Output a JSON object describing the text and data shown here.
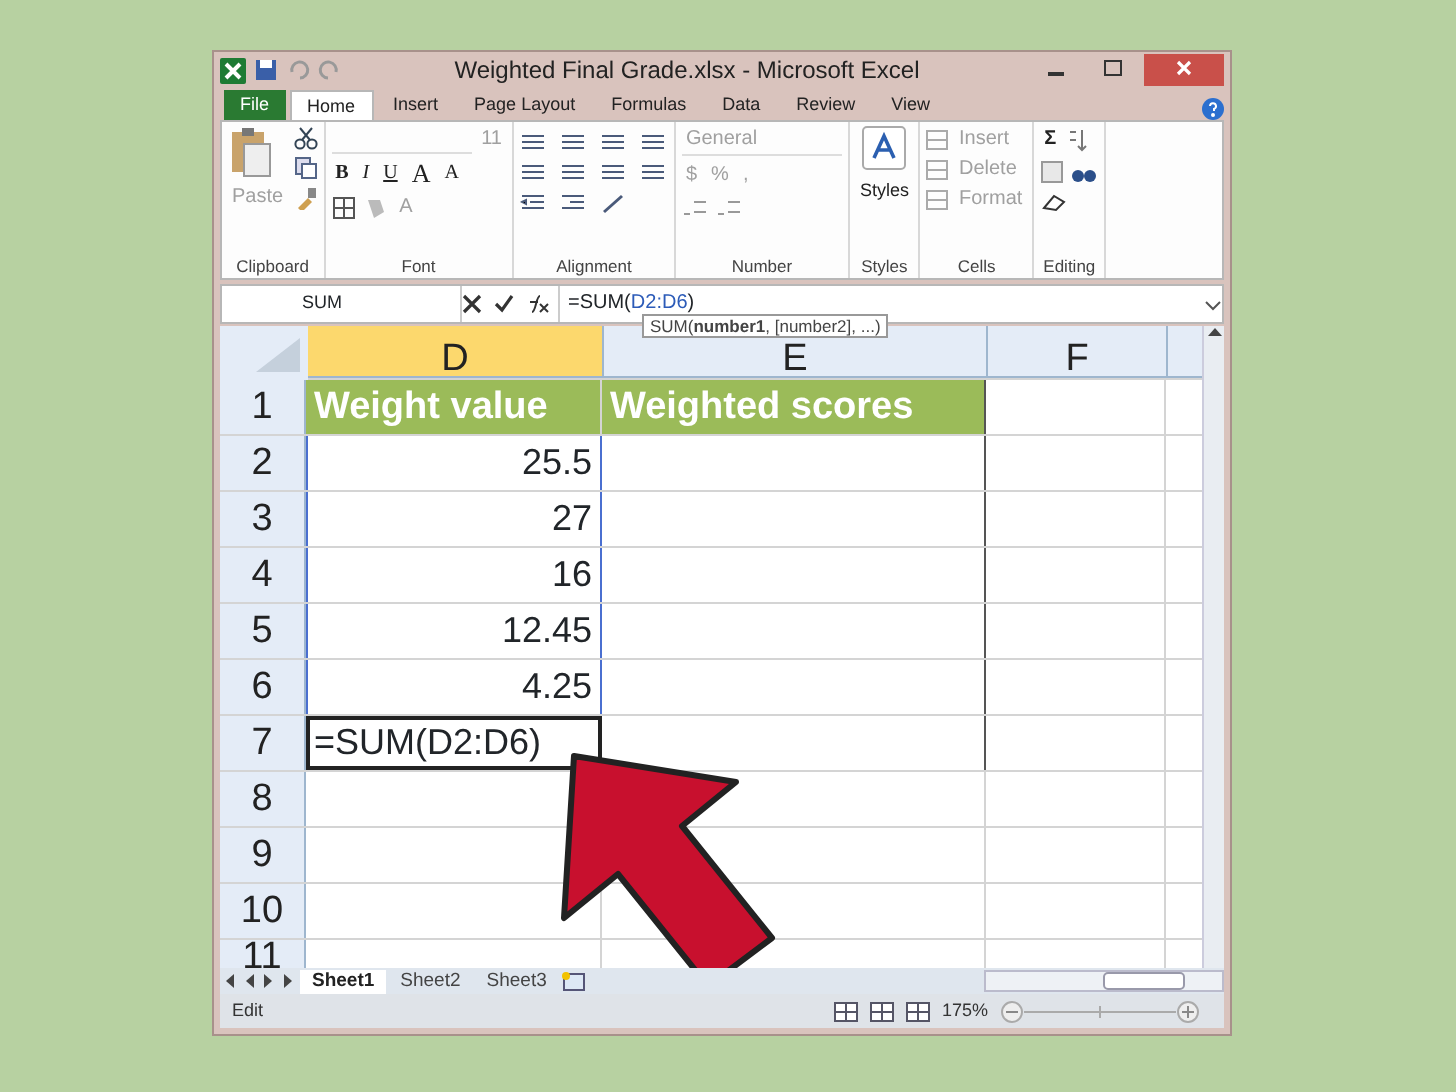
{
  "window": {
    "title": "Weighted Final Grade.xlsx - Microsoft Excel"
  },
  "ribbon_tabs": [
    {
      "label": "File",
      "kind": "file",
      "selected": false
    },
    {
      "label": "Home",
      "kind": "tab",
      "selected": true
    },
    {
      "label": "Insert",
      "kind": "tab",
      "selected": false
    },
    {
      "label": "Page Layout",
      "kind": "tab",
      "selected": false
    },
    {
      "label": "Formulas",
      "kind": "tab",
      "selected": false
    },
    {
      "label": "Data",
      "kind": "tab",
      "selected": false
    },
    {
      "label": "Review",
      "kind": "tab",
      "selected": false
    },
    {
      "label": "View",
      "kind": "tab",
      "selected": false
    }
  ],
  "ribbon_groups": [
    {
      "kind": "clipboard",
      "label": "Clipboard",
      "items": [
        {
          "label": "Paste",
          "disabled": true
        }
      ]
    },
    {
      "kind": "font",
      "label": "Font",
      "items": [
        {
          "label": "11",
          "disabled": true
        },
        {
          "label": "B",
          "disabled": false
        },
        {
          "label": "I",
          "disabled": false
        },
        {
          "label": "U",
          "disabled": false
        },
        {
          "label": "A",
          "disabled": false
        },
        {
          "label": "A",
          "disabled": false
        },
        {
          "label": "A",
          "disabled": true
        }
      ]
    },
    {
      "kind": "alignment",
      "label": "Alignment"
    },
    {
      "kind": "number",
      "label": "Number",
      "items": [
        {
          "label": "General",
          "disabled": true
        },
        {
          "label": "$",
          "disabled": true
        },
        {
          "label": "%",
          "disabled": true
        },
        {
          "label": ",",
          "disabled": true
        }
      ]
    },
    {
      "kind": "styles",
      "label": "Styles",
      "items": [
        {
          "label": "Styles",
          "disabled": false
        }
      ]
    },
    {
      "kind": "cells",
      "label": "Cells",
      "items": [
        {
          "label": "Insert",
          "disabled": true
        },
        {
          "label": "Delete",
          "disabled": true
        },
        {
          "label": "Format",
          "disabled": true
        }
      ]
    },
    {
      "kind": "editing",
      "label": "Editing",
      "items": [
        {
          "label": "Σ",
          "disabled": false
        }
      ]
    }
  ],
  "formula_bar": {
    "name_box": "SUM",
    "formula": [
      {
        "text": "=SUM(",
        "kind": "plain"
      },
      {
        "text": "D2:D6",
        "kind": "reference"
      },
      {
        "text": ")",
        "kind": "plain"
      }
    ],
    "tooltip": "SUM(**number1**, [number2], ...)"
  },
  "columns": [
    {
      "label": "D",
      "selected": true
    },
    {
      "label": "E",
      "selected": false
    },
    {
      "label": "F",
      "selected": false
    }
  ],
  "rows": [
    {
      "row": "1",
      "kind": "header",
      "d": "Weight value",
      "e": "Weighted scores"
    },
    {
      "row": "2",
      "kind": "value",
      "d": "25.5",
      "referenced": true
    },
    {
      "row": "3",
      "kind": "value",
      "d": "27",
      "referenced": true
    },
    {
      "row": "4",
      "kind": "value",
      "d": "16",
      "referenced": true
    },
    {
      "row": "5",
      "kind": "value",
      "d": "12.45",
      "referenced": true
    },
    {
      "row": "6",
      "kind": "value",
      "d": "4.25",
      "referenced": true
    },
    {
      "row": "7",
      "kind": "formula",
      "d": "=SUM(D2:D6)",
      "active": true
    },
    {
      "row": "8",
      "kind": "empty"
    },
    {
      "row": "9",
      "kind": "empty"
    },
    {
      "row": "10",
      "kind": "empty"
    },
    {
      "row": "11",
      "kind": "empty"
    }
  ],
  "sheet_tabs": [
    {
      "label": "Sheet1",
      "selected": true
    },
    {
      "label": "Sheet2",
      "selected": false
    },
    {
      "label": "Sheet3",
      "selected": false
    }
  ],
  "status_bar": {
    "mode": "Edit",
    "zoom": "175%"
  }
}
